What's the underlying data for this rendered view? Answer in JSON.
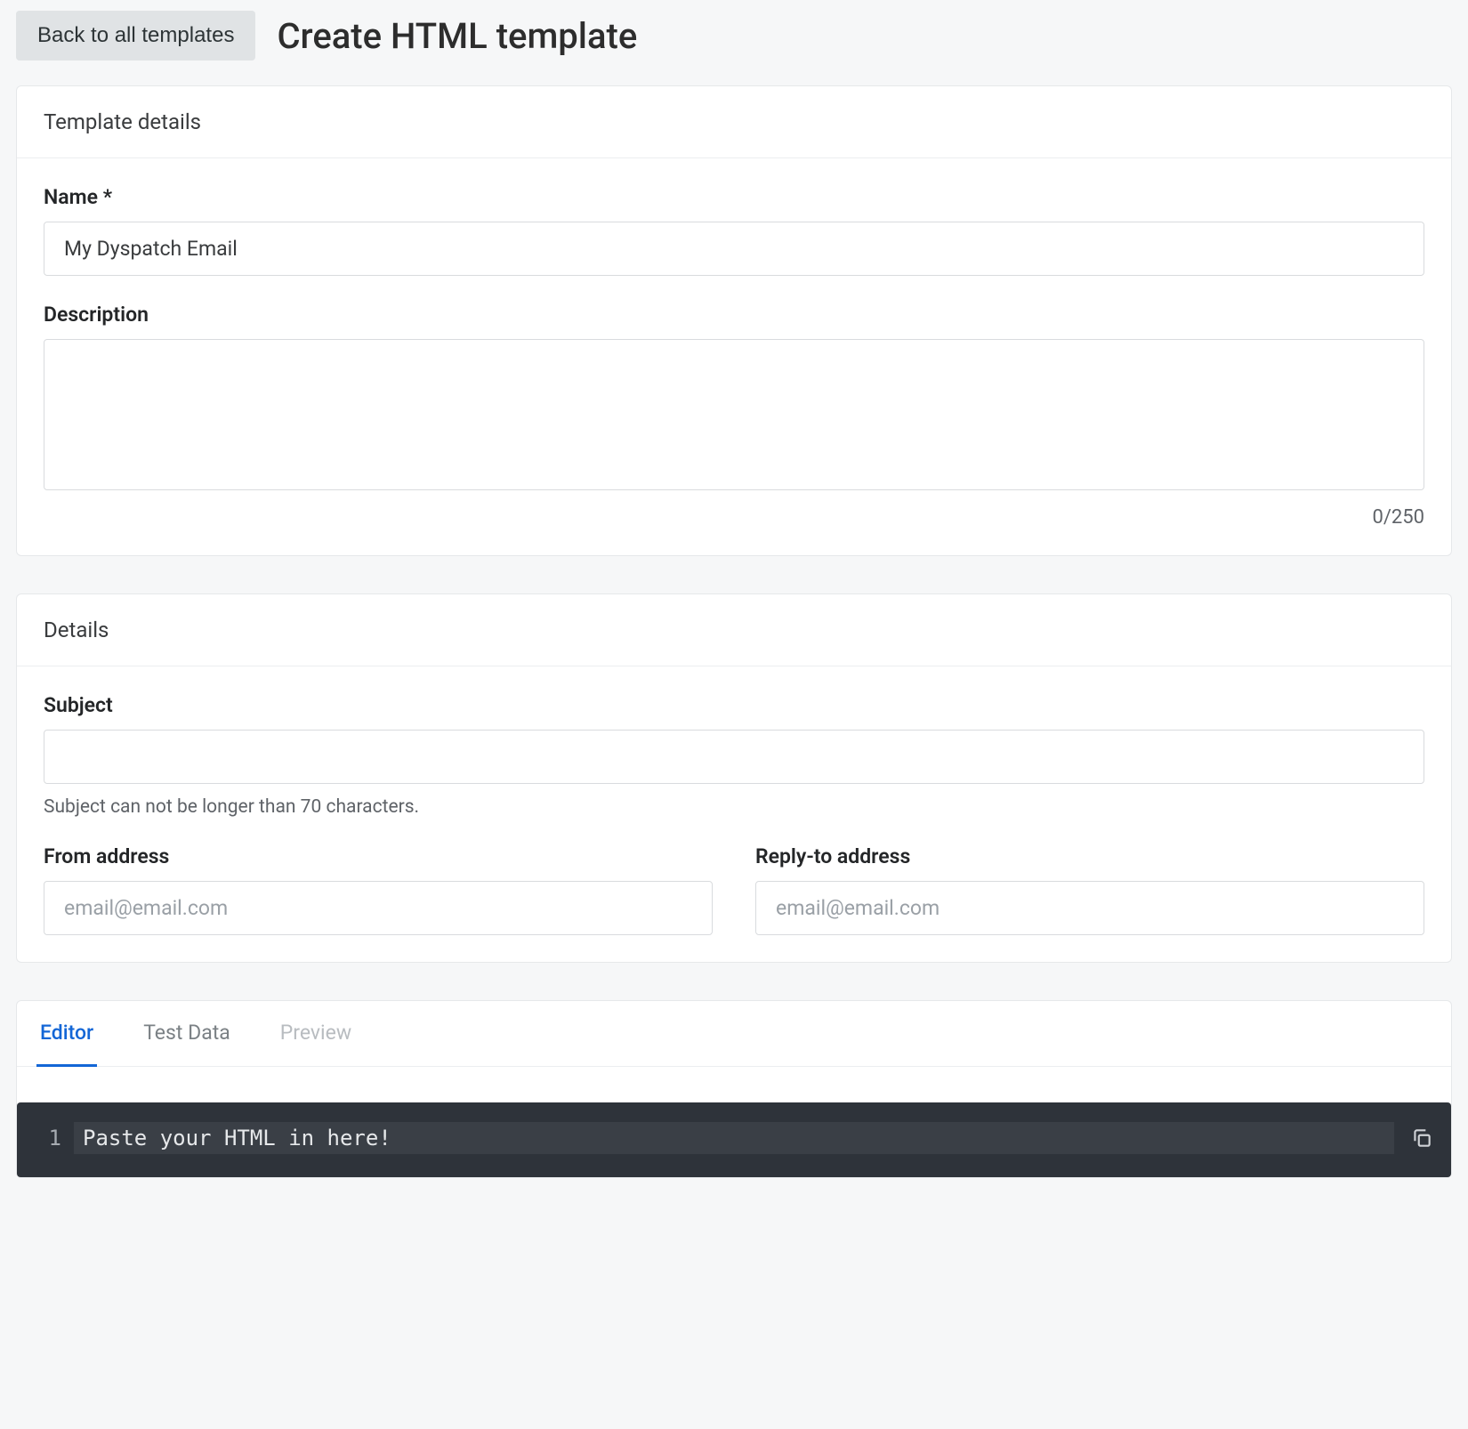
{
  "header": {
    "back_label": "Back to all templates",
    "title": "Create HTML template"
  },
  "template_details": {
    "section_title": "Template details",
    "name_label": "Name *",
    "name_value": "My Dyspatch Email",
    "description_label": "Description",
    "description_value": "",
    "char_count": "0/250"
  },
  "details": {
    "section_title": "Details",
    "subject_label": "Subject",
    "subject_value": "",
    "subject_hint": "Subject can not be longer than 70 characters.",
    "from_label": "From address",
    "from_placeholder": "email@email.com",
    "from_value": "",
    "reply_label": "Reply-to address",
    "reply_placeholder": "email@email.com",
    "reply_value": ""
  },
  "editor": {
    "tabs": {
      "editor": "Editor",
      "test_data": "Test Data",
      "preview": "Preview"
    },
    "line_number": "1",
    "code_placeholder": "Paste your HTML in here!"
  }
}
